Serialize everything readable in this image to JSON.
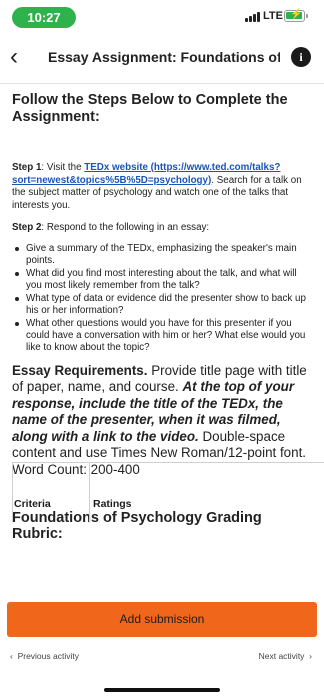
{
  "status": {
    "time": "10:27",
    "network": "LTE"
  },
  "header": {
    "title": "Essay Assignment: Foundations of..."
  },
  "instructions": {
    "title": "Follow the Steps Below to Complete the Assignment:",
    "step1_label": "Step 1",
    "step1_pre": ": Visit the ",
    "step1_link": "TEDx website (https://www.ted.com/talks?sort=newest&topics%5B%5D=psychology)",
    "step1_post": ". Search for a talk on the subject matter of psychology and watch one of the talks that interests you.",
    "step2_label": "Step 2",
    "step2_text": ": Respond to the following in an essay:",
    "bullets": [
      "Give a summary of the TEDx, emphasizing the speaker's main points.",
      "What did you find most interesting about the talk, and what will you most likely remember from the talk?",
      "What type of data or evidence did the presenter show to back up his or her information?",
      "What other questions would you have for this presenter if you could have a conversation with him or her? What else would you like to know about the topic?"
    ]
  },
  "essay": {
    "lead": "Essay Requirements.",
    "text1": " Provide title page with title of paper, name, and course. ",
    "emphasis": "At the top of your response, include the title of the TEDx, the name of the presenter, when it was filmed, along with a link to the video.",
    "text2": " Double-space content and use Times New Roman/12-point font. Word Count: 200-400"
  },
  "rubric": {
    "title": "Foundations of Psychology Grading Rubric:",
    "columns": [
      "Criteria",
      "Ratings"
    ]
  },
  "actions": {
    "add_submission": "Add submission",
    "previous": "Previous activity",
    "next": "Next activity"
  }
}
